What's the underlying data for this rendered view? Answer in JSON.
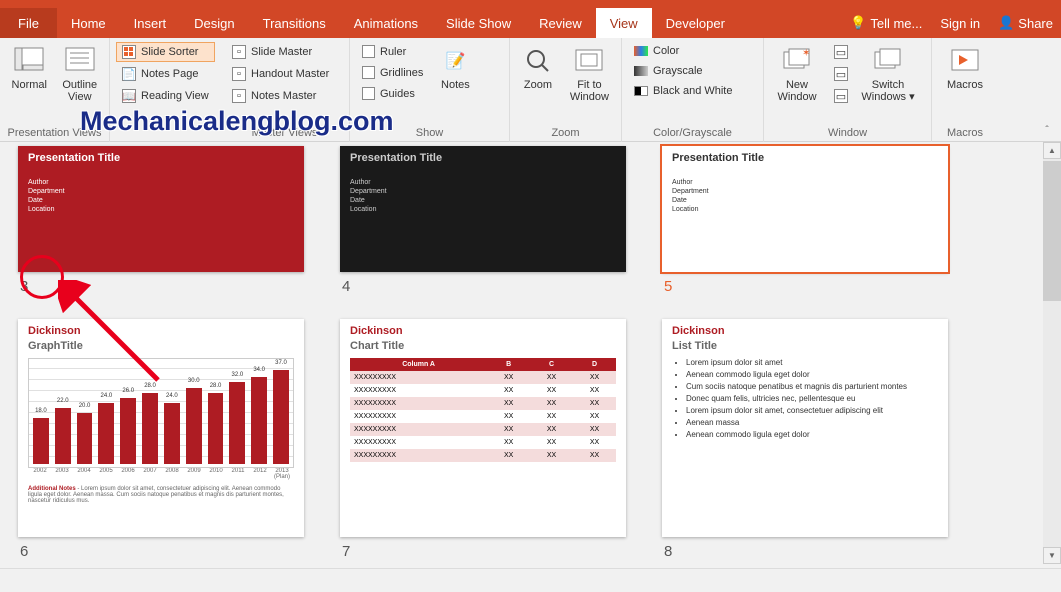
{
  "tabs": {
    "file": "File",
    "home": "Home",
    "insert": "Insert",
    "design": "Design",
    "transitions": "Transitions",
    "animations": "Animations",
    "slideshow": "Slide Show",
    "review": "Review",
    "view": "View",
    "developer": "Developer"
  },
  "tellme": "Tell me...",
  "signin": "Sign in",
  "share": "Share",
  "ribbon": {
    "presentation_views": {
      "normal": "Normal",
      "outline": "Outline\nView",
      "slide_sorter": "Slide Sorter",
      "notes_page": "Notes Page",
      "reading_view": "Reading View",
      "label": "Presentation Views"
    },
    "master_views": {
      "slide_master": "Slide Master",
      "handout_master": "Handout Master",
      "notes_master": "Notes Master",
      "label": "Master Views"
    },
    "show": {
      "ruler": "Ruler",
      "gridlines": "Gridlines",
      "guides": "Guides",
      "notes": "Notes",
      "label": "Show"
    },
    "zoom": {
      "zoom": "Zoom",
      "fit": "Fit to\nWindow",
      "label": "Zoom"
    },
    "color": {
      "color": "Color",
      "grayscale": "Grayscale",
      "bw": "Black and White",
      "label": "Color/Grayscale"
    },
    "window": {
      "new": "New\nWindow",
      "arrange": "",
      "cascade": "",
      "split": "",
      "switch": "Switch\nWindows",
      "label": "Window"
    },
    "macros": {
      "macros": "Macros",
      "label": "Macros"
    }
  },
  "watermark": "Mechanicalengblog.com",
  "slides": {
    "s3": {
      "num": "3",
      "title": "Presentation Title",
      "author": "Author",
      "dept": "Department",
      "date": "Date",
      "loc": "Location"
    },
    "s4": {
      "num": "4",
      "title": "Presentation Title",
      "author": "Author",
      "dept": "Department",
      "date": "Date",
      "loc": "Location"
    },
    "s5": {
      "num": "5",
      "title": "Presentation Title",
      "author": "Author",
      "dept": "Department",
      "date": "Date",
      "loc": "Location"
    },
    "s6": {
      "num": "6",
      "brand": "Dickinson",
      "title": "GraphTitle",
      "notes": "Additional Notes",
      "notes_body": " - Lorem ipsum dolor sit amet, consectetuer adipiscing elit. Aenean commodo ligula eget dolor. Aenean massa. Cum sociis natoque penatibus et magnis dis parturient montes, nascetur ridiculus mus."
    },
    "s7": {
      "num": "7",
      "brand": "Dickinson",
      "title": "Chart Title",
      "headers": [
        "Column A",
        "B",
        "C",
        "D"
      ],
      "row": "XXXXXXXXX",
      "cell": "XX"
    },
    "s8": {
      "num": "8",
      "brand": "Dickinson",
      "title": "List Title",
      "items": [
        "Lorem ipsum dolor sit amet",
        "Aenean commodo ligula eget dolor",
        "Cum sociis natoque penatibus et magnis dis parturient montes",
        "Donec quam felis, ultricies nec, pellentesque eu",
        "Lorem ipsum dolor sit amet, consectetuer adipiscing elit",
        "Aenean massa",
        "Aenean commodo ligula eget dolor"
      ]
    }
  },
  "chart_data": {
    "type": "bar",
    "title": "GraphTitle",
    "xlabel": "",
    "ylabel": "",
    "categories": [
      "2002",
      "2003",
      "2004",
      "2005",
      "2006",
      "2007",
      "2008",
      "2009",
      "2010",
      "2011",
      "2012",
      "2013 (Plan)"
    ],
    "values": [
      18,
      22,
      20,
      24,
      26,
      28,
      24,
      30,
      28,
      32,
      34,
      37
    ],
    "ylim": [
      0,
      40
    ]
  }
}
